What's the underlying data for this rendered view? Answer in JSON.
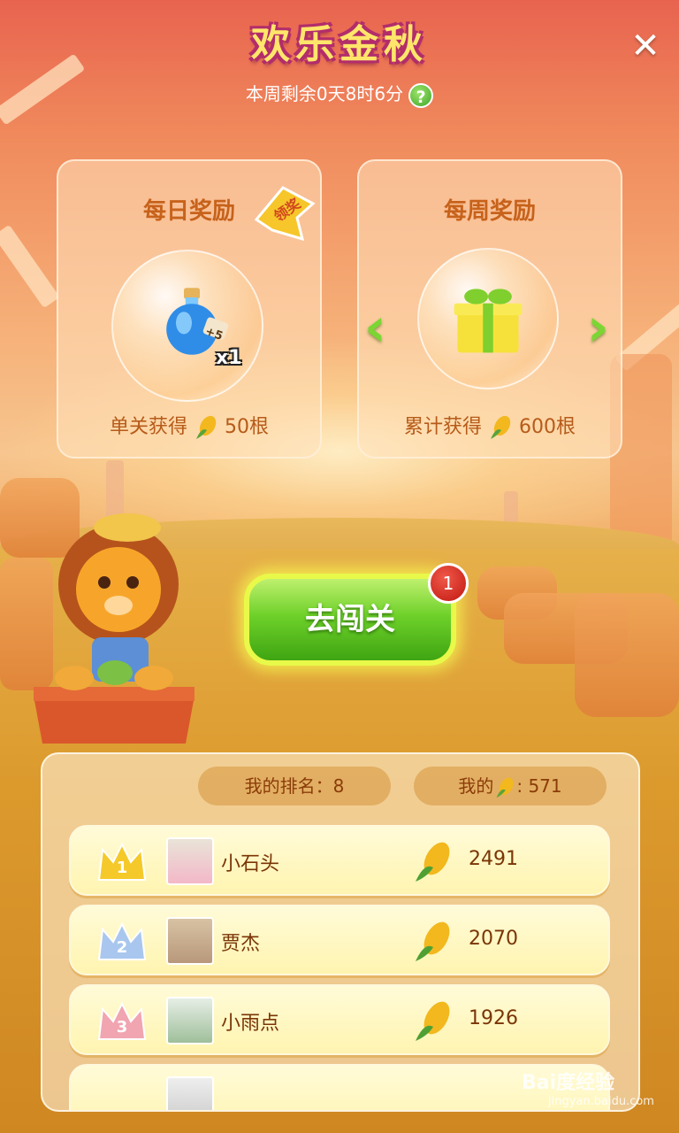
{
  "header": {
    "title": "欢乐金秋",
    "timer_text": "本周剩余0天8时6分",
    "help_label": "?",
    "close_label": "✕"
  },
  "daily_card": {
    "title": "每日奖励",
    "claim_label": "领奖",
    "reward_count": "x1",
    "reward_tag": "+5",
    "footer_prefix": "单关获得",
    "footer_value": "50根"
  },
  "weekly_card": {
    "title": "每周奖励",
    "prev_arrow": "‹",
    "next_arrow": "›",
    "footer_prefix": "累计获得",
    "footer_value": "600根"
  },
  "go_button": {
    "label": "去闯关",
    "badge": "1"
  },
  "leaderboard": {
    "my_rank_label": "我的排名：8",
    "my_corn_prefix": "我的",
    "my_corn_value": ": 571",
    "rows": [
      {
        "rank": "1",
        "name": "小石头",
        "score": "2491"
      },
      {
        "rank": "2",
        "name": "贾杰",
        "score": "2070"
      },
      {
        "rank": "3",
        "name": "小雨点",
        "score": "1926"
      }
    ]
  },
  "watermark": {
    "brand": "Bai度经验",
    "url": "jingyan.baidu.com"
  },
  "colors": {
    "title": "#ffe66a",
    "title_outline": "#b22d6b",
    "card_text": "#c7621b",
    "go_button": "#6ed12a",
    "badge": "#d8251a",
    "crown_gold": "#f5c929",
    "crown_silver": "#a9c7ee",
    "crown_bronze": "#f0a5b0"
  }
}
